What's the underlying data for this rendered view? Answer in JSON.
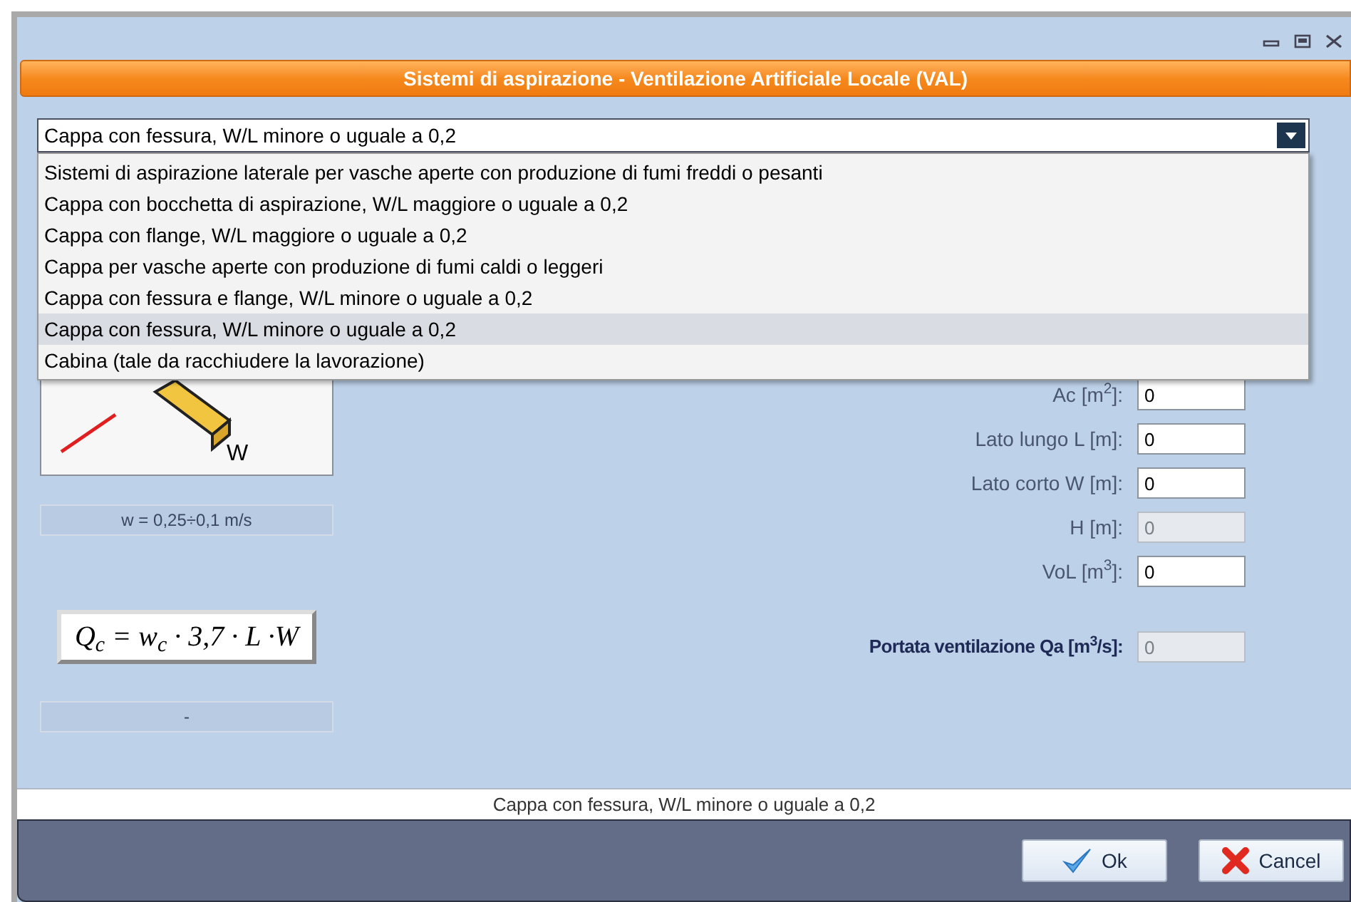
{
  "window": {
    "title": "Sistemi di aspirazione - Ventilazione Artificiale Locale (VAL)"
  },
  "combo": {
    "value": "Cappa con fessura, W/L minore o uguale a 0,2",
    "expanded": true,
    "options": [
      {
        "label": "Sistemi di aspirazione laterale per vasche aperte con produzione di fumi freddi o pesanti",
        "selected": false
      },
      {
        "label": "Cappa con bocchetta di aspirazione, W/L maggiore o uguale a 0,2",
        "selected": false
      },
      {
        "label": "Cappa con flange, W/L maggiore o uguale a 0,2",
        "selected": false
      },
      {
        "label": "Cappa per vasche aperte con produzione di fumi caldi o leggeri",
        "selected": false
      },
      {
        "label": "Cappa con fessura e flange, W/L minore o uguale a 0,2",
        "selected": false
      },
      {
        "label": "Cappa con fessura, W/L minore o uguale a 0,2",
        "selected": true
      },
      {
        "label": "Cabina (tale da racchiudere la lavorazione)",
        "selected": false
      }
    ]
  },
  "diagram": {
    "label": "W"
  },
  "speed": "w = 0,25÷0,1 m/s",
  "formula": "Q$_{c}$ = w$_{c}$ · 3,7 · L ·W",
  "note": "-",
  "fields": [
    {
      "label": "Ac [m$^{2}$]:",
      "value": "0",
      "disabled": false
    },
    {
      "label": "Lato lungo L [m]:",
      "value": "0",
      "disabled": false
    },
    {
      "label": "Lato corto W [m]:",
      "value": "0",
      "disabled": false
    },
    {
      "label": "H [m]:",
      "value": "0",
      "disabled": true
    },
    {
      "label": "VoL [m$^{3}$]:",
      "value": "0",
      "disabled": false
    }
  ],
  "result": {
    "label": "Portata ventilazione Qa [m$^{3}$/s]:",
    "value": "0",
    "disabled": true
  },
  "status": "Cappa con fessura, W/L minore o uguale a 0,2",
  "buttons": [
    {
      "kind": "ok",
      "label": "Ok"
    },
    {
      "kind": "cancel",
      "label": "Cancel"
    }
  ]
}
